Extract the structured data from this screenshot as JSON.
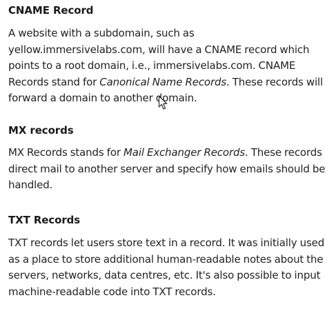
{
  "sections": [
    {
      "heading": "CNAME Record",
      "body": [
        {
          "text": "A website with a subdomain, such as yellow.immersivelabs.com, will have a CNAME record which points to a root domain, i.e., immersivelabs.com. CNAME Records stand for "
        },
        {
          "text": "Canonical Name Records",
          "italic": true
        },
        {
          "text": ". These records will forward a domain to another domain."
        }
      ]
    },
    {
      "heading": "MX records",
      "body": [
        {
          "text": "MX Records stands for "
        },
        {
          "text": "Mail Exchanger Records",
          "italic": true
        },
        {
          "text": ". These records direct mail to another server and specify how emails should be handled."
        }
      ]
    },
    {
      "heading": "TXT Records",
      "body": [
        {
          "text": "TXT records let users store text in a record. It was initially used as a place to store additional human-readable notes about the servers, networks, data centres, etc. It's also possible to input machine-readable code into TXT records."
        }
      ]
    }
  ],
  "cursor": {
    "icon": "mouse-pointer-icon"
  }
}
